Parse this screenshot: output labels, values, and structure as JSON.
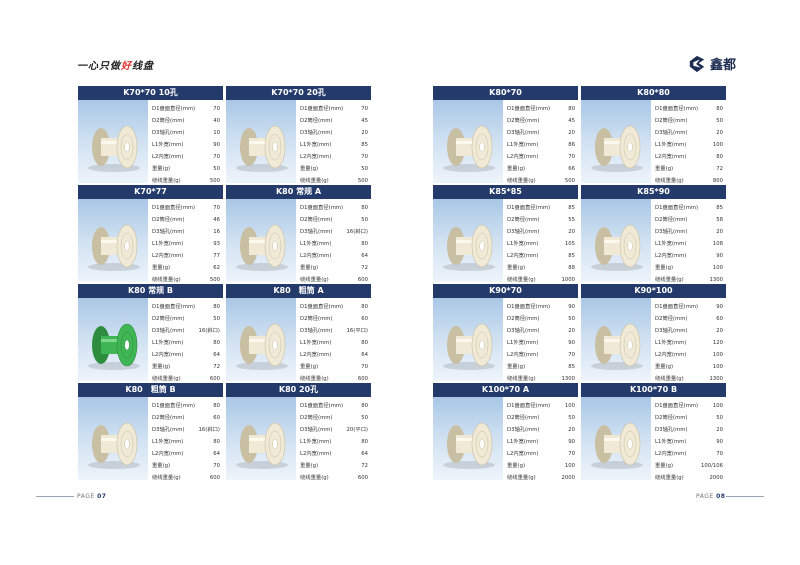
{
  "header": {
    "slogan_a": "一心只做",
    "slogan_hl": "好",
    "slogan_b": "线盘",
    "brand": "鑫都"
  },
  "footer": {
    "left_label": "PAGE",
    "left_num": "07",
    "right_label": "PAGE",
    "right_num": "08"
  },
  "colors": {
    "title_bar": "#233a6b",
    "photo_bg": "#b9d3ec",
    "spool_cream": "#efe9d6",
    "spool_green": "#3fb553"
  },
  "spec_labels": [
    "D1盘面直径(mm)",
    "D2筒径(mm)",
    "D3轴孔(mm)",
    "L1外宽(mm)",
    "L2内宽(mm)",
    "重量(g)",
    "绕线重量(g)"
  ],
  "products": [
    {
      "title": "K70*70 10孔",
      "color": "cream",
      "specs": [
        "70",
        "40",
        "10",
        "90",
        "70",
        "50",
        "500"
      ]
    },
    {
      "title": "K70*70 20孔",
      "color": "cream",
      "specs": [
        "70",
        "45",
        "20",
        "85",
        "70",
        "50",
        "500"
      ]
    },
    {
      "title": "K70*77",
      "color": "cream",
      "specs": [
        "70",
        "46",
        "16",
        "93",
        "77",
        "62",
        "500"
      ]
    },
    {
      "title": "K80 常规 A",
      "color": "cream",
      "specs": [
        "80",
        "50",
        "16(斜口)",
        "80",
        "64",
        "72",
        "600"
      ]
    },
    {
      "title": "K80 常规 B",
      "color": "green",
      "specs": [
        "80",
        "50",
        "16(斜口)",
        "80",
        "64",
        "72",
        "600"
      ]
    },
    {
      "title": "K80　粗筒 A",
      "color": "cream",
      "specs": [
        "80",
        "60",
        "16(平口)",
        "80",
        "64",
        "70",
        "600"
      ]
    },
    {
      "title": "K80　粗筒 B",
      "color": "cream",
      "specs": [
        "80",
        "60",
        "16(斜口)",
        "80",
        "64",
        "70",
        "600"
      ]
    },
    {
      "title": "K80 20孔",
      "color": "cream",
      "specs": [
        "80",
        "50",
        "20(平口)",
        "80",
        "64",
        "72",
        "600"
      ]
    },
    {
      "title": "K80*70",
      "color": "cream",
      "specs": [
        "80",
        "45",
        "20",
        "86",
        "70",
        "66",
        "500"
      ]
    },
    {
      "title": "K80*80",
      "color": "cream",
      "specs": [
        "80",
        "50",
        "20",
        "100",
        "80",
        "72",
        "800"
      ]
    },
    {
      "title": "K85*85",
      "color": "cream",
      "specs": [
        "85",
        "55",
        "20",
        "105",
        "85",
        "88",
        "1000"
      ]
    },
    {
      "title": "K85*90",
      "color": "cream",
      "specs": [
        "85",
        "58",
        "20",
        "108",
        "90",
        "100",
        "1300"
      ]
    },
    {
      "title": "K90*70",
      "color": "cream",
      "specs": [
        "90",
        "50",
        "20",
        "90",
        "70",
        "85",
        "1300"
      ]
    },
    {
      "title": "K90*100",
      "color": "cream",
      "specs": [
        "90",
        "60",
        "20",
        "120",
        "100",
        "100",
        "1300"
      ]
    },
    {
      "title": "K100*70 A",
      "color": "cream",
      "specs": [
        "100",
        "50",
        "20",
        "90",
        "70",
        "100",
        "2000"
      ]
    },
    {
      "title": "K100*70 B",
      "color": "cream",
      "specs": [
        "100",
        "50",
        "20",
        "90",
        "70",
        "100/106",
        "2000"
      ]
    }
  ]
}
